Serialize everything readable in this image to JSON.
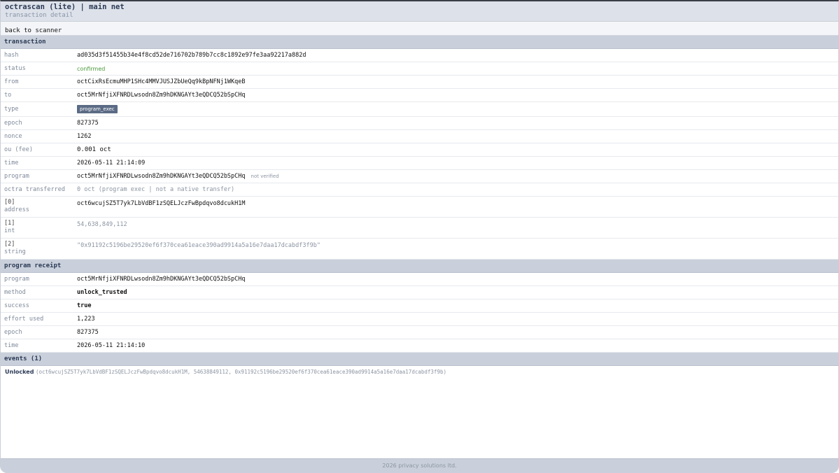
{
  "header": {
    "title": "octrascan (lite) | main net",
    "subtitle": "transaction detail"
  },
  "nav": {
    "back_label": "back to scanner"
  },
  "transaction": {
    "section_label": "transaction",
    "rows": [
      {
        "label": "hash",
        "value": "ad035d3f51455b34e4f8cd52de716702b789b7cc8c1892e97fe3aa92217a882d"
      },
      {
        "label": "status",
        "value": "confirmed"
      },
      {
        "label": "from",
        "value": "octCixRsEcmuMHP1SHc4MMVJUSJZbUeQq9kBpNFNj1WKqeB"
      },
      {
        "label": "to",
        "value": "oct5MrNfjiXFNRDLwsodn8Zm9hDKNGAYt3eQDCQ52bSpCHq"
      },
      {
        "label": "type",
        "value": "program_exec"
      },
      {
        "label": "epoch",
        "value": "827375"
      },
      {
        "label": "nonce",
        "value": "1262"
      },
      {
        "label": "ou (fee)",
        "value": "0.001 oct"
      },
      {
        "label": "time",
        "value": "2026-05-11 21:14:09"
      },
      {
        "label": "program",
        "value": "oct5MrNfjiXFNRDLwsodn8Zm9hDKNGAYt3eQDCQ52bSpCHq",
        "note": "not verified"
      },
      {
        "label": "octra transferred",
        "value": "0 oct (program exec | not a native transfer)"
      }
    ],
    "params": [
      {
        "index": "[0]",
        "type": "address",
        "value": "oct6wcujSZ5T7yk7LbVdBF1zSQELJczFwBpdqvo8dcukH1M"
      },
      {
        "index": "[1]",
        "type": "int",
        "value": "54,638,849,112"
      },
      {
        "index": "[2]",
        "type": "string",
        "value": "\"0x91192c5196be29520ef6f370cea61eace390ad9914a5a16e7daa17dcabdf3f9b\""
      }
    ]
  },
  "receipt": {
    "section_label": "program receipt",
    "rows": [
      {
        "label": "program",
        "value": "oct5MrNfjiXFNRDLwsodn8Zm9hDKNGAYt3eQDCQ52bSpCHq"
      },
      {
        "label": "method",
        "value": "unlock_trusted"
      },
      {
        "label": "success",
        "value": "true"
      },
      {
        "label": "effort used",
        "value": "1,223"
      },
      {
        "label": "epoch",
        "value": "827375"
      },
      {
        "label": "time",
        "value": "2026-05-11 21:14:10"
      }
    ]
  },
  "events": {
    "section_label": "events (1)",
    "items": [
      {
        "name": "Unlocked",
        "args": "(oct6wcujSZ5T7yk7LbVdBF1zSQELJczFwBpdqvo8dcukH1M, 54638849112, 0x91192c5196be29520ef6f370cea61eace390ad9914a5a16e7daa17dcabdf3f9b)"
      }
    ]
  },
  "footer": {
    "text": "2026 privacy solutions ltd."
  },
  "colors": {
    "accent": "#2b3a55",
    "status_confirmed": "#4a9a3a",
    "badge_bg": "#5b6b85",
    "section_bg": "#c9d0db"
  }
}
